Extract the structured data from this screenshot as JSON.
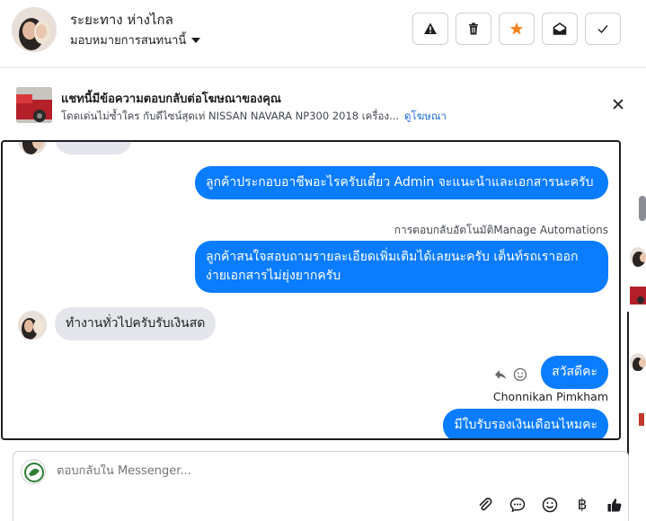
{
  "header": {
    "contact_name": "ระยะทาง ห่างไกล",
    "assign_label": "มอบหมายการสนทนานี้",
    "toolbar": [
      "mark-spam",
      "delete",
      "star",
      "mark-unread",
      "done"
    ]
  },
  "ad_banner": {
    "title": "แชทนี้มีข้อความตอบกลับต่อโฆษณาของคุณ",
    "description": "โดดเด่นไม่ซ้ำใคร กับดีไซน์สุดเท่ NISSAN NAVARA NP300 2018 เครื่อง...",
    "link": "ดูโฆษณา"
  },
  "messages": {
    "out_1": "ลูกค้าประกอบอาชีพอะไรครับเดี๋ยว Admin จะแนะนำและเอกสารนะครับ",
    "auto_reply_label": "การตอบกลับอัตโนมัติ",
    "manage_link": "Manage Automations",
    "out_2": "ลูกค้าสนใจสอบถามรายละเอียดเพิ่มเติมได้เลยนะครับ เต็นท์รถเราออกง่ายเอกสารไม่ยุ่งยากครับ",
    "in_1": "ทำงานทั่วไปครับรับเงินสด",
    "out_3": "สวัสดีคะ",
    "sender_name": "Chonnikan Pimkham",
    "out_4": "มีใบรับรองเงินเดือนไหมคะ"
  },
  "composer": {
    "placeholder": "ตอบกลับใน Messenger...",
    "currency_symbol": "฿"
  },
  "colors": {
    "accent": "#0a7cff",
    "star": "#f5821f",
    "link": "#216fdb"
  }
}
